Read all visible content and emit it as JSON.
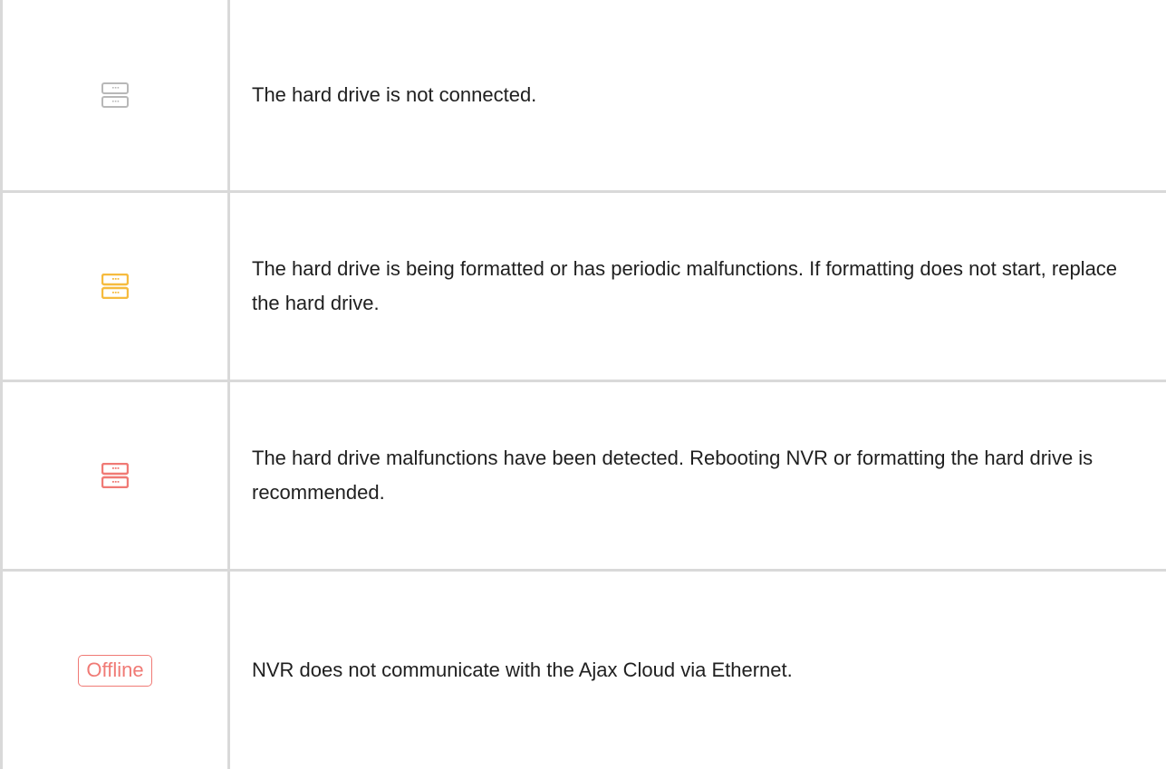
{
  "colors": {
    "neutral": "#b8b8b8",
    "warning": "#f6bb3e",
    "error": "#f07a75"
  },
  "rows": [
    {
      "icon": "hard-drive-grey-icon",
      "text": "The hard drive is not connected."
    },
    {
      "icon": "hard-drive-yellow-icon",
      "text": "The hard drive is being formatted or has periodic malfunctions. If formatting does not start, replace the hard drive."
    },
    {
      "icon": "hard-drive-red-icon",
      "text": "The hard drive malfunctions have been detected. Rebooting NVR or formatting the hard drive is recommended."
    },
    {
      "badge": "Offline",
      "text": "NVR does not communicate with the Ajax Cloud via Ethernet."
    }
  ]
}
